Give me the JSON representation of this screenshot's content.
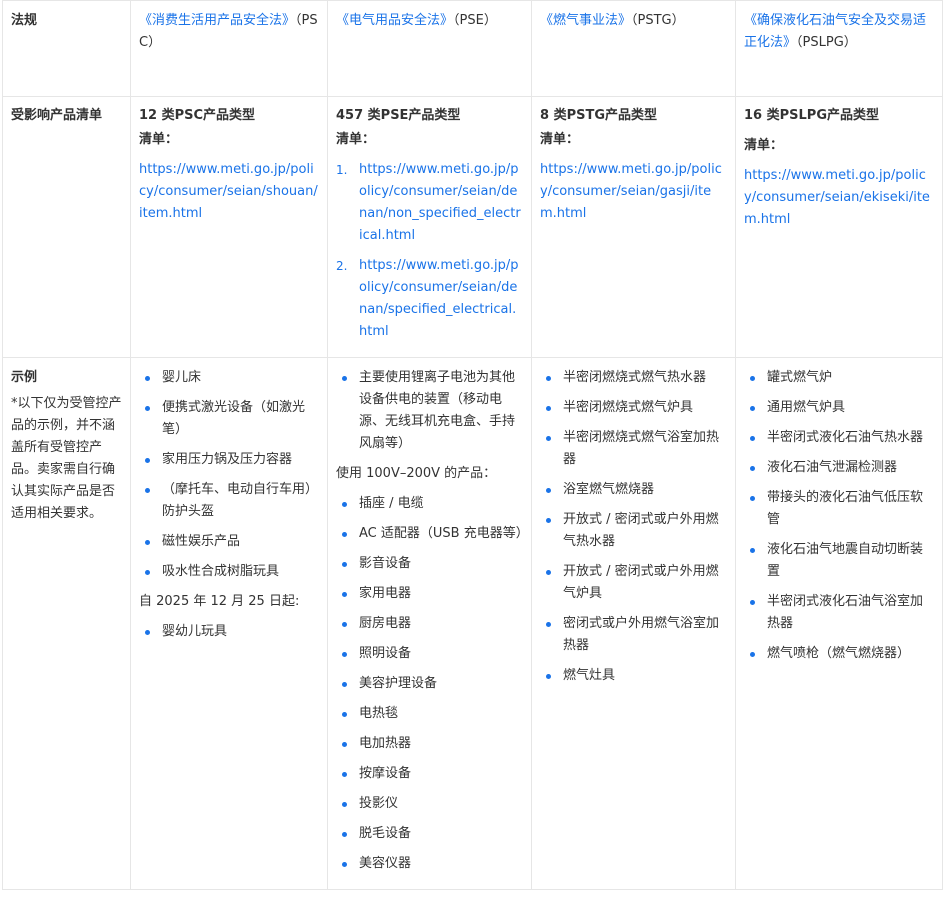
{
  "rows": {
    "law": {
      "header": "法规",
      "cells": [
        {
          "link": "《消费生活用产品安全法》",
          "abbr": "（PSC）"
        },
        {
          "link": "《电气用品安全法》",
          "abbr": "（PSE）"
        },
        {
          "link": "《燃气事业法》",
          "abbr": "（PSTG）"
        },
        {
          "link": "《确保液化石油气安全及交易适正化法》",
          "abbr": "（PSLPG）"
        }
      ]
    },
    "list": {
      "header": "受影响产品清单",
      "cells": [
        {
          "title": "12 类PSC产品类型",
          "label": "清单：",
          "urls": [
            "https://www.meti.go.jp/policy/consumer/seian/shouan/item.html"
          ]
        },
        {
          "title": "457 类PSE产品类型",
          "label": "清单：",
          "numbered": [
            {
              "num": "1.",
              "url": "https://www.meti.go.jp/policy/consumer/seian/denan/non_specified_electrical.html"
            },
            {
              "num": "2.",
              "url": "https://www.meti.go.jp/policy/consumer/seian/denan/specified_electrical.html"
            }
          ]
        },
        {
          "title": "8 类PSTG产品类型",
          "label": "清单：",
          "urls": [
            "https://www.meti.go.jp/policy/consumer/seian/gasji/item.html"
          ]
        },
        {
          "title": "16 类PSLPG产品类型",
          "label": "清单：",
          "urls": [
            "https://www.meti.go.jp/policy/consumer/seian/ekiseki/item.html"
          ]
        }
      ]
    },
    "examples": {
      "header": "示例",
      "note": "*以下仅为受管控产品的示例，并不涵盖所有受管控产品。卖家需自行确认其实际产品是否适用相关要求。",
      "psc": {
        "items": [
          "婴儿床",
          "便携式激光设备（如激光笔）",
          "家用压力锅及压力容器",
          "（摩托车、电动自行车用）防护头盔",
          "磁性娱乐产品",
          "吸水性合成树脂玩具"
        ],
        "sub": "自 2025 年 12 月 25 日起:",
        "items2": [
          "婴幼儿玩具"
        ]
      },
      "pse": {
        "items": [
          "主要使用锂离子电池为其他设备供电的装置（移动电源、无线耳机充电盒、手持风扇等）"
        ],
        "sub": "使用 100V–200V 的产品：",
        "items2": [
          "插座 / 电缆",
          "AC 适配器（USB 充电器等）",
          "影音设备",
          "家用电器",
          "厨房电器",
          "照明设备",
          "美容护理设备",
          "电热毯",
          "电加热器",
          "按摩设备",
          "投影仪",
          "脱毛设备",
          "美容仪器"
        ]
      },
      "pstg": {
        "items": [
          "半密闭燃烧式燃气热水器",
          "半密闭燃烧式燃气炉具",
          "半密闭燃烧式燃气浴室加热器",
          "浴室燃气燃烧器",
          "开放式 / 密闭式或户外用燃气热水器",
          "开放式 / 密闭式或户外用燃气炉具",
          "密闭式或户外用燃气浴室加热器",
          "燃气灶具"
        ]
      },
      "pslpg": {
        "items": [
          "罐式燃气炉",
          "通用燃气炉具",
          "半密闭式液化石油气热水器",
          "液化石油气泄漏检测器",
          "带接头的液化石油气低压软管",
          "液化石油气地震自动切断装置",
          "半密闭式液化石油气浴室加热器",
          "燃气喷枪（燃气燃烧器）"
        ]
      }
    }
  },
  "colors": {
    "link": "#1a73e8",
    "border": "#e6e6e6",
    "text": "#333333"
  }
}
